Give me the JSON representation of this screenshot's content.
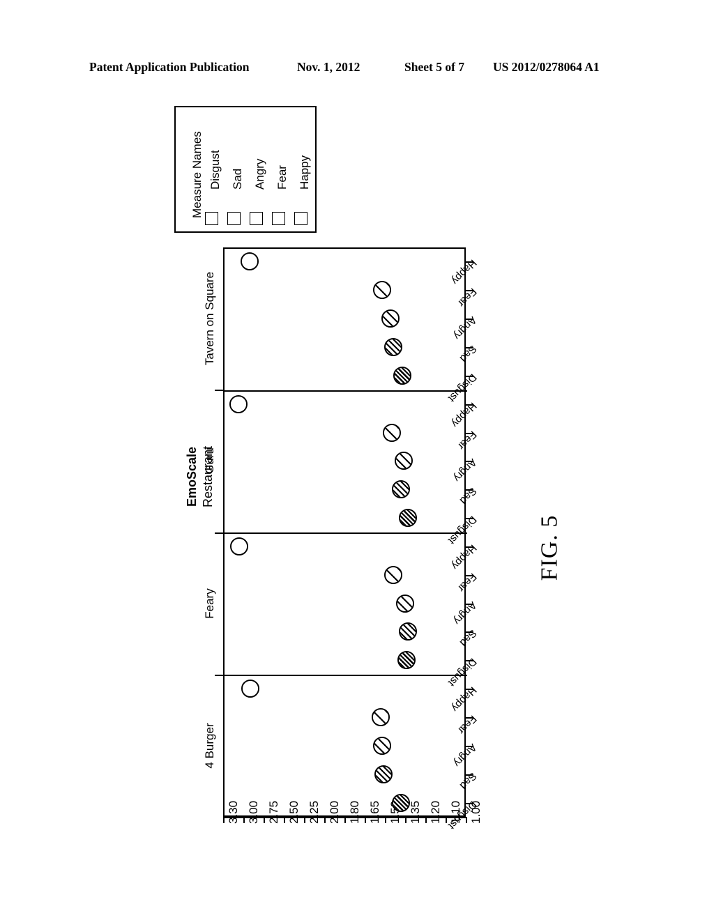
{
  "patent_header": {
    "publication": "Patent Application Publication",
    "date": "Nov. 1, 2012",
    "sheet": "Sheet 5 of 7",
    "number": "US 2012/0278064 A1"
  },
  "figure": {
    "caption": "FIG. 5"
  },
  "legend": {
    "title": "Measure Names",
    "entries": [
      {
        "label": "Disgust",
        "hatch": "hatch-1"
      },
      {
        "label": "Sad",
        "hatch": "hatch-2"
      },
      {
        "label": "Angry",
        "hatch": "hatch-3"
      },
      {
        "label": "Fear",
        "hatch": "hatch-4"
      },
      {
        "label": "Happy",
        "hatch": "hatch-5"
      }
    ]
  },
  "chart_data": {
    "type": "scatter",
    "title": "EmoScale",
    "xlabel": "Restaurant",
    "ylabel": "EmoScale",
    "grid": false,
    "legend_position": "top-left",
    "orientation": "horizontal-panels",
    "axis_ticks": [
      "3.30",
      "3.00",
      "2.75",
      "2.50",
      "2.25",
      "2.00",
      "1.80",
      "1.65",
      "1.50",
      "1.35",
      "1.20",
      "1.10",
      "1.00"
    ],
    "axis_range": [
      "3.30",
      "1.00"
    ],
    "categories": [
      "Disgust",
      "Sad",
      "Angry",
      "Fear",
      "Happy"
    ],
    "panels": [
      {
        "name": "Tavern on Square",
        "points": [
          {
            "measure": "Disgust",
            "value": 1.37,
            "hatch": "hatch-1"
          },
          {
            "measure": "Sad",
            "value": 1.44,
            "hatch": "hatch-2"
          },
          {
            "measure": "Angry",
            "value": 1.46,
            "hatch": "hatch-3"
          },
          {
            "measure": "Fear",
            "value": 1.52,
            "hatch": "hatch-4"
          },
          {
            "measure": "Happy",
            "value": 2.92,
            "hatch": "hatch-5"
          }
        ]
      },
      {
        "name": "Guru",
        "points": [
          {
            "measure": "Disgust",
            "value": 1.33,
            "hatch": "hatch-1"
          },
          {
            "measure": "Sad",
            "value": 1.38,
            "hatch": "hatch-2"
          },
          {
            "measure": "Angry",
            "value": 1.36,
            "hatch": "hatch-3"
          },
          {
            "measure": "Fear",
            "value": 1.45,
            "hatch": "hatch-4"
          },
          {
            "measure": "Happy",
            "value": 3.07,
            "hatch": "hatch-5"
          }
        ]
      },
      {
        "name": "Feary",
        "points": [
          {
            "measure": "Disgust",
            "value": 1.34,
            "hatch": "hatch-1"
          },
          {
            "measure": "Sad",
            "value": 1.33,
            "hatch": "hatch-2"
          },
          {
            "measure": "Angry",
            "value": 1.35,
            "hatch": "hatch-3"
          },
          {
            "measure": "Fear",
            "value": 1.44,
            "hatch": "hatch-4"
          },
          {
            "measure": "Happy",
            "value": 3.06,
            "hatch": "hatch-5"
          }
        ]
      },
      {
        "name": "4 Burger",
        "points": [
          {
            "measure": "Disgust",
            "value": 1.38,
            "hatch": "hatch-1"
          },
          {
            "measure": "Sad",
            "value": 1.51,
            "hatch": "hatch-2"
          },
          {
            "measure": "Angry",
            "value": 1.52,
            "hatch": "hatch-3"
          },
          {
            "measure": "Fear",
            "value": 1.53,
            "hatch": "hatch-4"
          },
          {
            "measure": "Happy",
            "value": 2.91,
            "hatch": "hatch-5"
          }
        ]
      }
    ]
  }
}
